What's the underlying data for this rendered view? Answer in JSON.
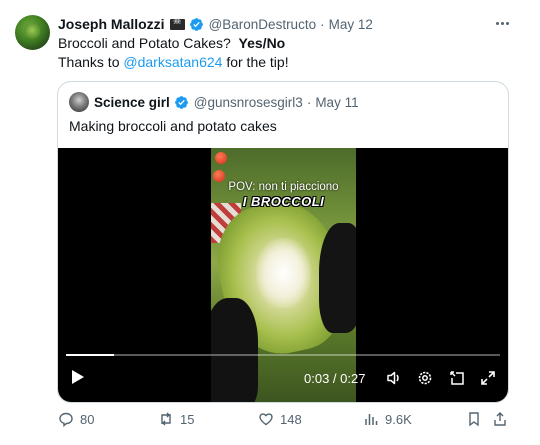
{
  "tweet": {
    "author_name": "Joseph Mallozzi",
    "handle": "@BaronDestructo",
    "separator": "·",
    "date": "May 12",
    "text_line1": "Broccoli and Potato Cakes?",
    "text_line1_bold": "Yes/No",
    "text_line2_prefix": "Thanks to",
    "mention": "@darksatan624",
    "text_line2_suffix": "for the tip!"
  },
  "quoted": {
    "author_name": "Science girl",
    "handle": "@gunsnrosesgirl3",
    "separator": "·",
    "date": "May 11",
    "text": "Making broccoli and potato cakes",
    "video": {
      "caption_line1": "POV: non ti piacciono",
      "caption_line2": "I BROCCOLI",
      "time": "0:03 / 0:27",
      "progress": 0.111
    }
  },
  "actions": {
    "replies": "80",
    "reposts": "15",
    "likes": "148",
    "views": "9.6K"
  },
  "colors": {
    "accent": "#1d9bf0",
    "muted": "#536471",
    "text": "#0f1419",
    "border": "#cfd9de"
  },
  "icons": [
    "more-icon",
    "verified-icon",
    "pirate-flag-icon",
    "play-icon",
    "volume-icon",
    "settings-icon",
    "pip-icon",
    "fullscreen-icon",
    "reply-icon",
    "repost-icon",
    "like-icon",
    "views-icon",
    "bookmark-icon",
    "share-icon"
  ]
}
